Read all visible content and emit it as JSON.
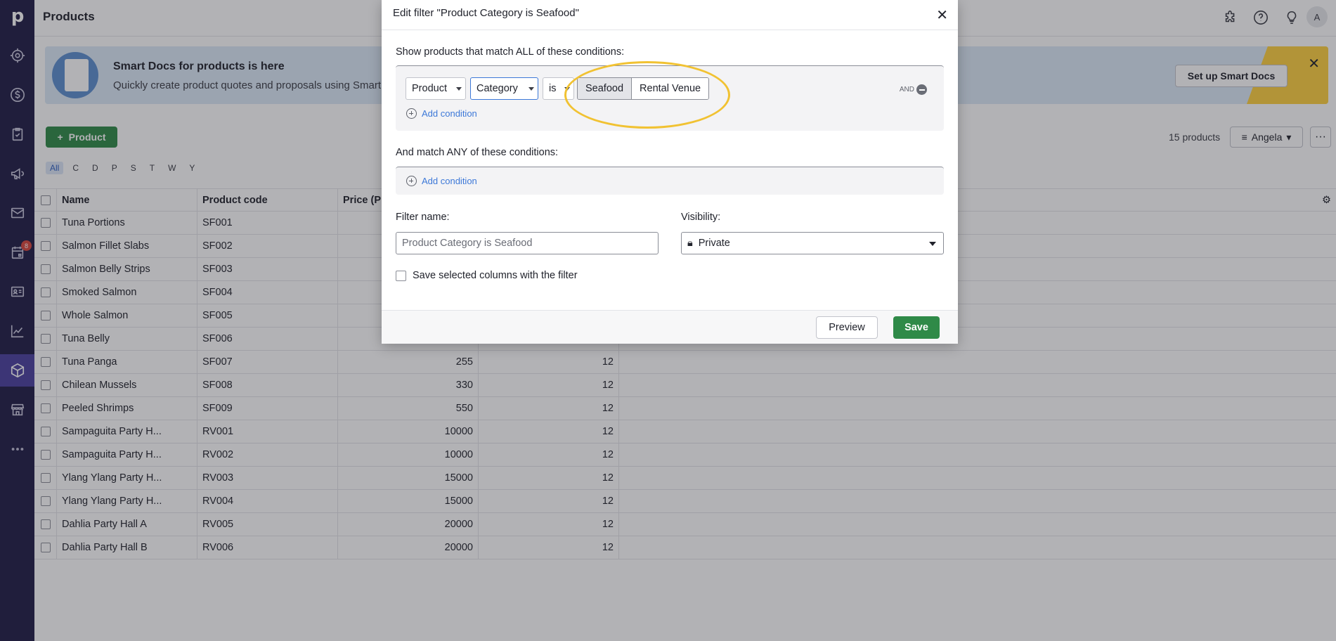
{
  "app": {
    "logo": "p",
    "page_title": "Products",
    "avatar": "A"
  },
  "sidebar": {
    "items": [
      {
        "icon": "target-icon"
      },
      {
        "icon": "dollar-icon"
      },
      {
        "icon": "checklist-icon"
      },
      {
        "icon": "megaphone-icon"
      },
      {
        "icon": "mail-icon"
      },
      {
        "icon": "calendar-icon",
        "badge": "8"
      },
      {
        "icon": "contact-card-icon"
      },
      {
        "icon": "chart-icon"
      },
      {
        "icon": "box-icon",
        "active": true
      },
      {
        "icon": "store-icon"
      },
      {
        "icon": "more-icon"
      }
    ]
  },
  "header_icons": [
    "puzzle-icon",
    "help-icon",
    "lightbulb-icon"
  ],
  "banner": {
    "title": "Smart Docs for products is here",
    "text": "Quickly create product quotes and proposals using Smart",
    "button": "Set up Smart Docs"
  },
  "toolbar": {
    "add_label": "Product",
    "count": "15 products",
    "owner": "Angela",
    "more": "···"
  },
  "alphabet": [
    "All",
    "C",
    "D",
    "P",
    "S",
    "T",
    "W",
    "Y"
  ],
  "table": {
    "headers": [
      "Name",
      "Product code",
      "Price (P"
    ],
    "rows": [
      [
        "Tuna Portions",
        "SF001",
        "",
        ""
      ],
      [
        "Salmon Fillet Slabs",
        "SF002",
        "",
        ""
      ],
      [
        "Salmon Belly Strips",
        "SF003",
        "",
        ""
      ],
      [
        "Smoked Salmon",
        "SF004",
        "",
        ""
      ],
      [
        "Whole Salmon",
        "SF005",
        "",
        ""
      ],
      [
        "Tuna Belly",
        "SF006",
        "",
        ""
      ],
      [
        "Tuna Panga",
        "SF007",
        "255",
        "12"
      ],
      [
        "Chilean Mussels",
        "SF008",
        "330",
        "12"
      ],
      [
        "Peeled Shrimps",
        "SF009",
        "550",
        "12"
      ],
      [
        "Sampaguita Party H...",
        "RV001",
        "10000",
        "12"
      ],
      [
        "Sampaguita Party H...",
        "RV002",
        "10000",
        "12"
      ],
      [
        "Ylang Ylang Party H...",
        "RV003",
        "15000",
        "12"
      ],
      [
        "Ylang Ylang Party H...",
        "RV004",
        "15000",
        "12"
      ],
      [
        "Dahlia Party Hall A",
        "RV005",
        "20000",
        "12"
      ],
      [
        "Dahlia Party Hall B",
        "RV006",
        "20000",
        "12"
      ]
    ]
  },
  "modal": {
    "title": "Edit filter \"Product Category is Seafood\"",
    "all_label": "Show products that match ALL of these conditions:",
    "condition": {
      "entity": "Product",
      "field": "Category",
      "operator": "is",
      "options": [
        "Seafood",
        "Rental Venue"
      ],
      "selected": "Seafood"
    },
    "and_label": "AND",
    "add_condition": "Add condition",
    "any_label": "And match ANY of these conditions:",
    "filter_name_label": "Filter name:",
    "filter_name_placeholder": "Product Category is Seafood",
    "visibility_label": "Visibility:",
    "visibility_value": "Private",
    "save_columns_label": "Save selected columns with the filter",
    "preview_button": "Preview",
    "save_button": "Save"
  }
}
